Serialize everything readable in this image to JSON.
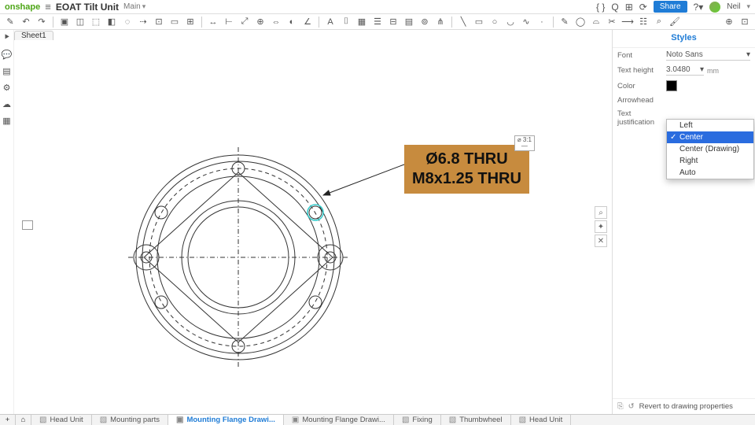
{
  "header": {
    "brand": "onshape",
    "title": "EOAT Tilt Unit",
    "subtitle": "Main",
    "share": "Share",
    "user": "Neil"
  },
  "sheet": {
    "tab": "Sheet1"
  },
  "styles": {
    "title": "Styles",
    "font_label": "Font",
    "font_value": "Noto Sans",
    "textheight_label": "Text height",
    "textheight_value": "3.0480",
    "textheight_unit": "mm",
    "color_label": "Color",
    "arrowhead_label": "Arrowhead",
    "justify_label": "Text justification",
    "revert": "Revert to drawing properties"
  },
  "dropdown": {
    "options": [
      "Left",
      "Center",
      "Center (Drawing)",
      "Right",
      "Auto"
    ],
    "selected": "Center"
  },
  "callout": {
    "line1": "Ø6.8 THRU",
    "line2": "M8x1.25 THRU"
  },
  "scale": {
    "top": "⌀ 3:1",
    "bot": "—"
  },
  "bottom": {
    "tabs": [
      {
        "label": "Head Unit"
      },
      {
        "label": "Mounting parts"
      },
      {
        "label": "Mounting Flange Drawi...",
        "active": true
      },
      {
        "label": "Mounting Flange Drawi..."
      },
      {
        "label": "Fixing"
      },
      {
        "label": "Thumbwheel"
      },
      {
        "label": "Head Unit"
      }
    ]
  }
}
